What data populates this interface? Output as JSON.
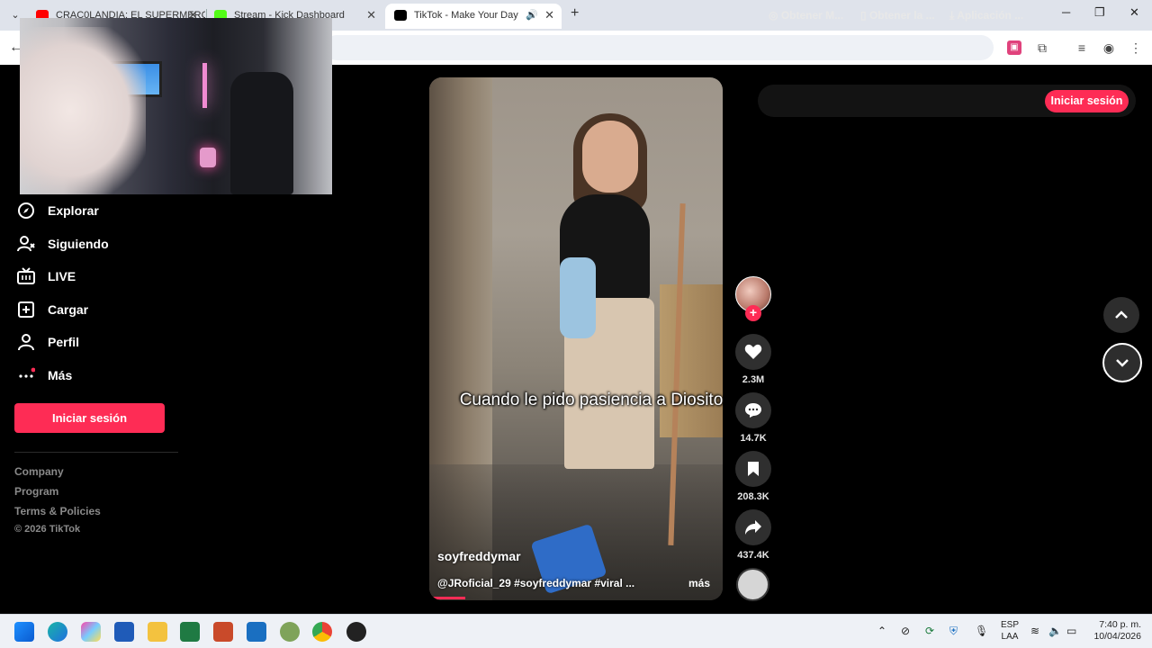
{
  "browser": {
    "tabs": [
      {
        "title": "CRAC0LANDIA: EL SUPERMERC",
        "favicon": "youtube-icon",
        "color": "#ff0000"
      },
      {
        "title": "Stream - Kick Dashboard",
        "favicon": "kick-icon",
        "color": "#53fc18"
      },
      {
        "title": "TikTok - Make Your Day",
        "favicon": "tiktok-icon",
        "color": "#000000"
      }
    ]
  },
  "sidebar": {
    "items": [
      {
        "label": "Explorar",
        "icon": "compass-icon"
      },
      {
        "label": "Siguiendo",
        "icon": "following-icon"
      },
      {
        "label": "LIVE",
        "icon": "live-tv-icon"
      },
      {
        "label": "Cargar",
        "icon": "upload-plus-icon"
      },
      {
        "label": "Perfil",
        "icon": "profile-icon"
      },
      {
        "label": "Más",
        "icon": "more-dots-icon"
      }
    ],
    "login": "Iniciar sesión",
    "footer": [
      "Company",
      "Program",
      "Terms & Policies"
    ],
    "copyright": "© 2026 TikTok"
  },
  "video": {
    "caption": "Cuando le pido pasiencia a Diosito",
    "author": "soyfreddymar",
    "description": "@JRoficial_29 #soyfreddymar #viral ...",
    "more": "más"
  },
  "actions": {
    "likes": "2.3M",
    "comments": "14.7K",
    "saves": "208.3K",
    "shares": "437.4K"
  },
  "topbar": {
    "item1": "Obtener M...",
    "item2": "Obtener la ...",
    "item3": "Aplicación ...",
    "login": "Iniciar sesión"
  },
  "taskbar": {
    "lang1": "ESP",
    "lang2": "LAA",
    "time": "7:40 p. m.",
    "date": "10/04/2026"
  },
  "colors": {
    "accent": "#fe2c55"
  }
}
